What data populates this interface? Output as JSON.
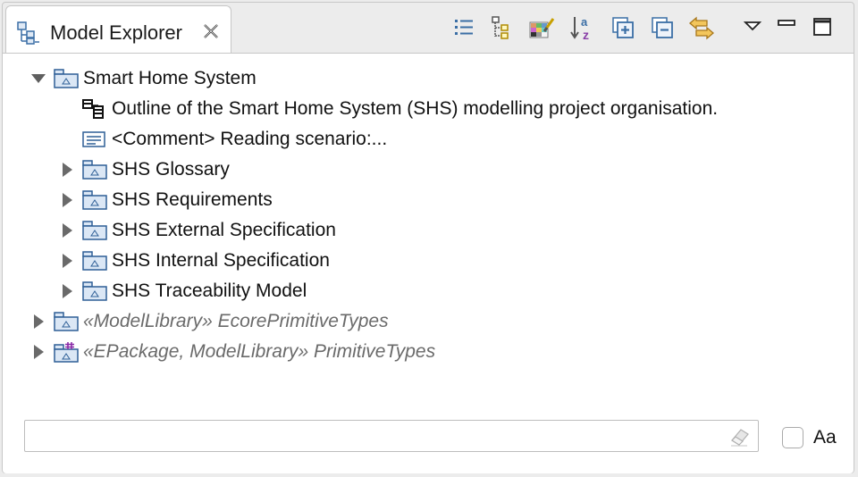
{
  "tab": {
    "title": "Model Explorer",
    "icon": "model-explorer-icon",
    "close_icon": "close-icon"
  },
  "toolbar": [
    {
      "name": "list-view-icon"
    },
    {
      "name": "tree-view-icon"
    },
    {
      "name": "customize-icon"
    },
    {
      "name": "sort-alphabetically-icon"
    },
    {
      "name": "expand-all-icon"
    },
    {
      "name": "collapse-all-icon"
    },
    {
      "name": "link-with-editor-icon"
    },
    {
      "name": "view-menu-icon"
    },
    {
      "name": "minimize-icon"
    },
    {
      "name": "maximize-icon"
    }
  ],
  "tree": [
    {
      "label": "Smart Home System",
      "expanded": true,
      "icon": "package-icon",
      "level": 0
    },
    {
      "label": "Outline of the Smart Home System (SHS) modelling project organisation.",
      "icon": "diagram-icon",
      "level": 1
    },
    {
      "label": "<Comment> Reading scenario:...",
      "icon": "comment-icon",
      "level": 1
    },
    {
      "label": "SHS Glossary",
      "expanded": false,
      "icon": "package-icon",
      "level": 1
    },
    {
      "label": "SHS Requirements",
      "expanded": false,
      "icon": "package-icon",
      "level": 1
    },
    {
      "label": "SHS External Specification",
      "expanded": false,
      "icon": "package-icon",
      "level": 1
    },
    {
      "label": "SHS Internal Specification",
      "expanded": false,
      "icon": "package-icon",
      "level": 1
    },
    {
      "label": "SHS Traceability Model",
      "expanded": false,
      "icon": "package-icon",
      "level": 1
    },
    {
      "label": "«ModelLibrary» EcorePrimitiveTypes",
      "expanded": false,
      "icon": "package-icon",
      "level": 0,
      "italic": true
    },
    {
      "label": "«EPackage, ModelLibrary» PrimitiveTypes",
      "expanded": false,
      "icon": "epackage-icon",
      "level": 0,
      "italic": true
    }
  ],
  "filter": {
    "value": "",
    "placeholder": "",
    "clear_icon": "eraser-icon"
  },
  "case_toggle": {
    "label": "Aa",
    "checked": false
  }
}
